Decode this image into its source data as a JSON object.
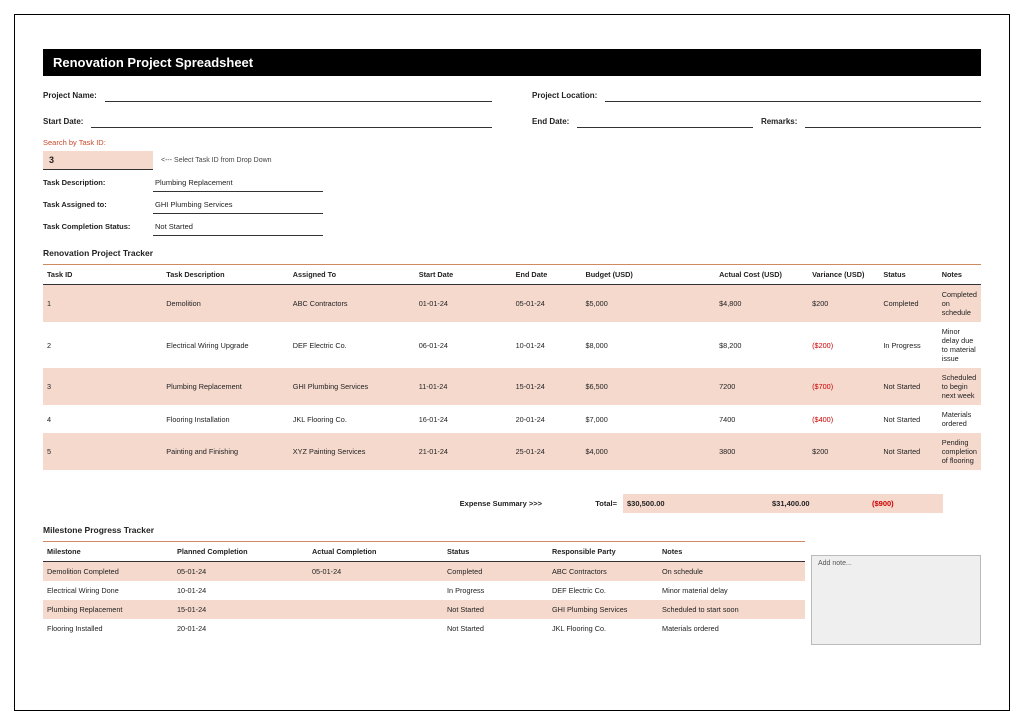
{
  "title": "Renovation Project Spreadsheet",
  "meta": {
    "project_name_label": "Project Name:",
    "project_location_label": "Project Location:",
    "start_date_label": "Start Date:",
    "end_date_label": "End Date:",
    "remarks_label": "Remarks:"
  },
  "search": {
    "label": "Search by Task ID:",
    "value": "3",
    "hint": "<--- Select Task ID from Drop Down",
    "rows": [
      {
        "label": "Task Description:",
        "value": "Plumbing Replacement"
      },
      {
        "label": "Task Assigned to:",
        "value": "GHI Plumbing Services"
      },
      {
        "label": "Task Completion Status:",
        "value": "Not Started"
      }
    ]
  },
  "tracker": {
    "title": "Renovation Project Tracker",
    "headers": [
      "Task ID",
      "Task Description",
      "Assigned To",
      "Start Date",
      "End Date",
      "Budget (USD)",
      "Actual Cost (USD)",
      "Variance (USD)",
      "Status",
      "Notes"
    ],
    "rows": [
      [
        "1",
        "Demolition",
        "ABC Contractors",
        "01-01-24",
        "05-01-24",
        "$5,000",
        "$4,800",
        "$200",
        "Completed",
        "Completed on schedule"
      ],
      [
        "2",
        "Electrical Wiring Upgrade",
        "DEF Electric Co.",
        "06-01-24",
        "10-01-24",
        "$8,000",
        "$8,200",
        "($200)",
        "In Progress",
        "Minor delay due to material issue"
      ],
      [
        "3",
        "Plumbing Replacement",
        "GHI Plumbing Services",
        "11-01-24",
        "15-01-24",
        "$6,500",
        "7200",
        "($700)",
        "Not Started",
        "Scheduled to begin next week"
      ],
      [
        "4",
        "Flooring Installation",
        "JKL Flooring Co.",
        "16-01-24",
        "20-01-24",
        "$7,000",
        "7400",
        "($400)",
        "Not Started",
        "Materials ordered"
      ],
      [
        "5",
        "Painting and Finishing",
        "XYZ Painting Services",
        "21-01-24",
        "25-01-24",
        "$4,000",
        "3800",
        "$200",
        "Not Started",
        "Pending completion of flooring"
      ]
    ]
  },
  "expense": {
    "label": "Expense Summary >>>",
    "total_label": "Total=",
    "budget_total": "$30,500.00",
    "actual_total": "$31,400.00",
    "variance_total": "($900)"
  },
  "milestone": {
    "title": "Milestone Progress Tracker",
    "headers": [
      "Milestone",
      "Planned Completion",
      "Actual Completion",
      "Status",
      "Responsible Party",
      "Notes"
    ],
    "rows": [
      [
        "Demolition Completed",
        "05-01-24",
        "05-01-24",
        "Completed",
        "ABC Contractors",
        "On schedule"
      ],
      [
        "Electrical Wiring Done",
        "10-01-24",
        "",
        "In Progress",
        "DEF Electric Co.",
        "Minor material delay"
      ],
      [
        "Plumbing Replacement",
        "15-01-24",
        "",
        "Not Started",
        "GHI Plumbing Services",
        "Scheduled to start soon"
      ],
      [
        "Flooring Installed",
        "20-01-24",
        "",
        "Not Started",
        "JKL Flooring Co.",
        "Materials ordered"
      ]
    ],
    "note_placeholder": "Add note..."
  }
}
